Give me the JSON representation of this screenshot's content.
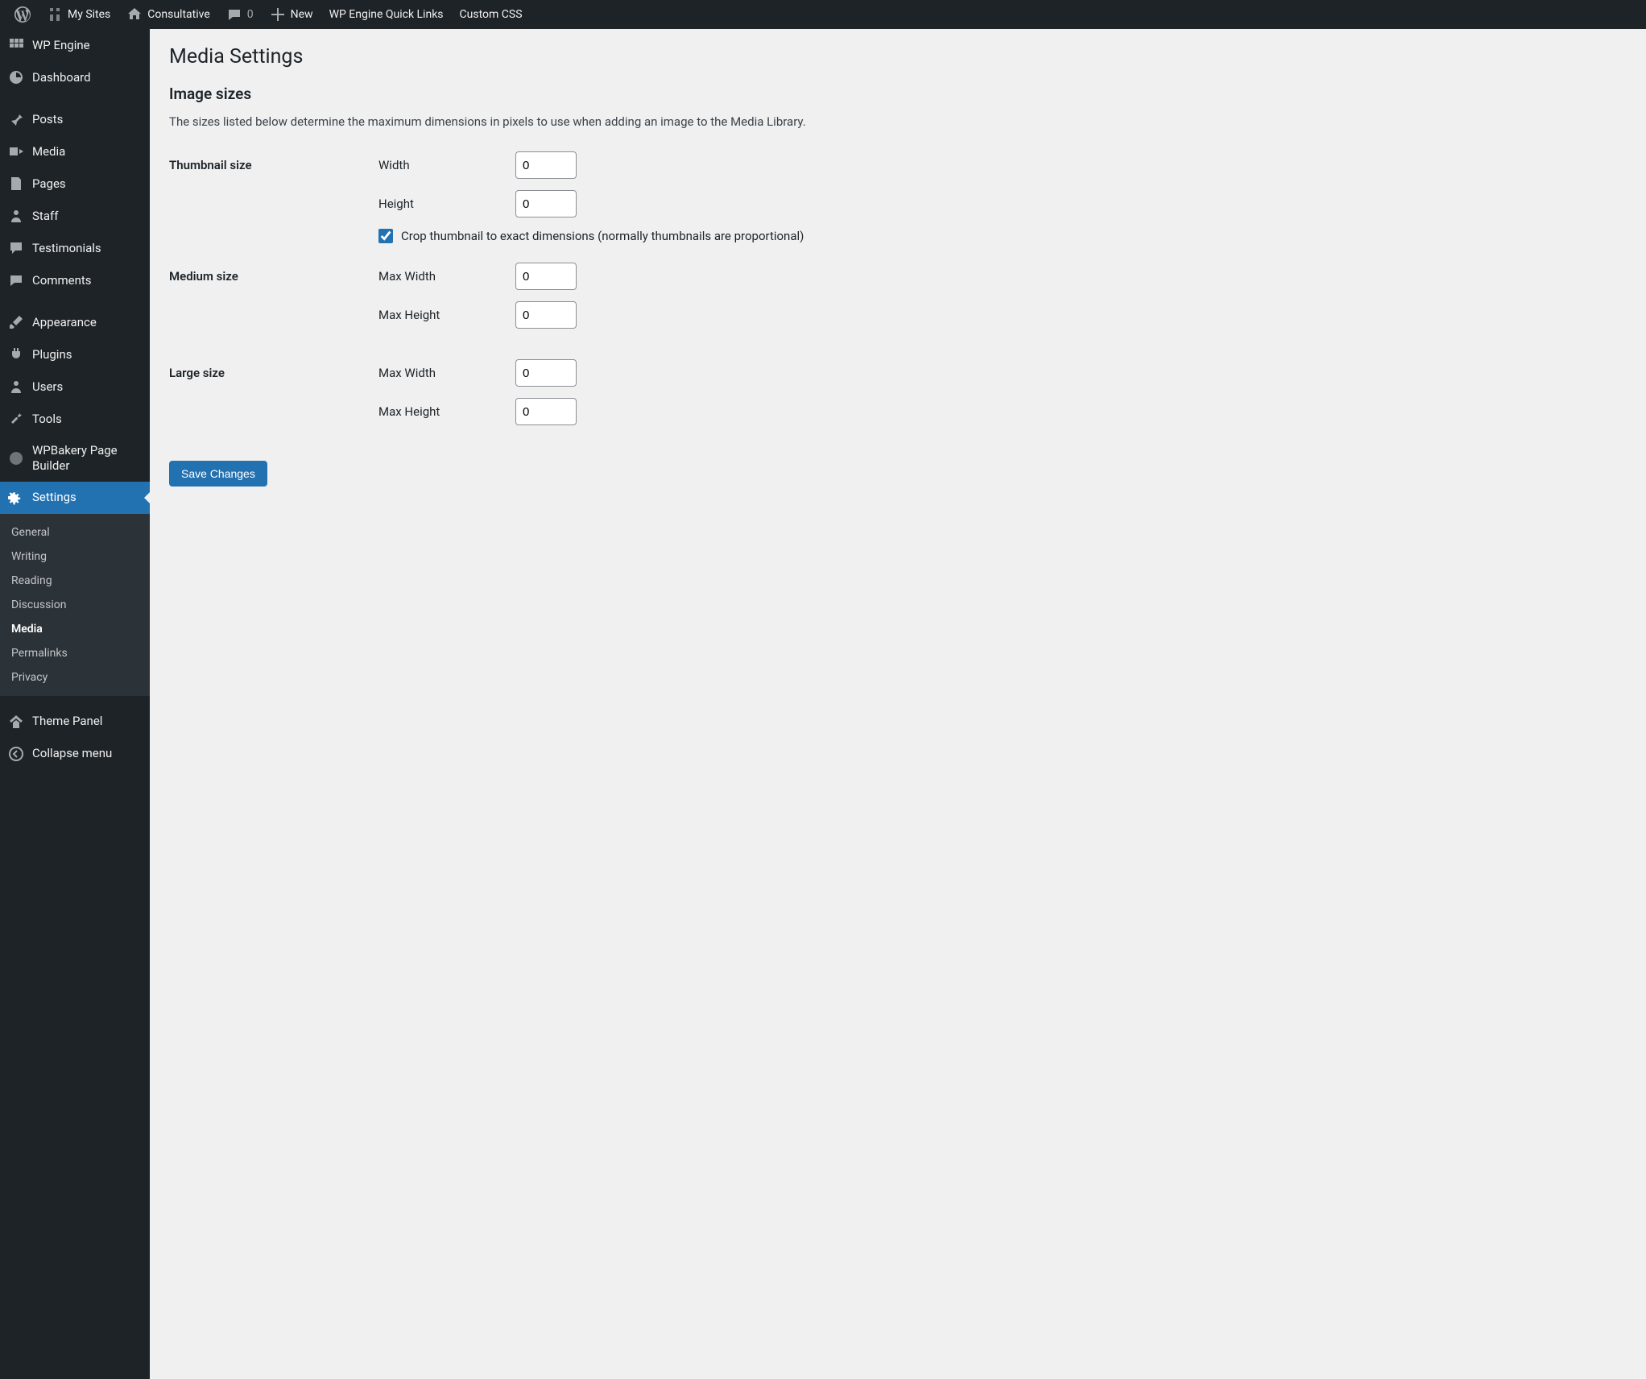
{
  "adminbar": {
    "mysites": "My Sites",
    "sitename": "Consultative",
    "comments": "0",
    "new": "New",
    "wpengine": "WP Engine Quick Links",
    "customcss": "Custom CSS"
  },
  "sidebar": {
    "wpengine": "WP Engine",
    "dashboard": "Dashboard",
    "posts": "Posts",
    "media": "Media",
    "pages": "Pages",
    "staff": "Staff",
    "testimonials": "Testimonials",
    "comments": "Comments",
    "appearance": "Appearance",
    "plugins": "Plugins",
    "users": "Users",
    "tools": "Tools",
    "wpbakery": "WPBakery Page Builder",
    "settings": "Settings",
    "themepanel": "Theme Panel",
    "collapse": "Collapse menu"
  },
  "submenu": {
    "general": "General",
    "writing": "Writing",
    "reading": "Reading",
    "discussion": "Discussion",
    "media": "Media",
    "permalinks": "Permalinks",
    "privacy": "Privacy"
  },
  "page": {
    "title": "Media Settings",
    "section": "Image sizes",
    "desc": "The sizes listed below determine the maximum dimensions in pixels to use when adding an image to the Media Library.",
    "thumbnail": {
      "heading": "Thumbnail size",
      "width_label": "Width",
      "width_value": "0",
      "height_label": "Height",
      "height_value": "0",
      "crop_label": "Crop thumbnail to exact dimensions (normally thumbnails are proportional)",
      "crop_checked": true
    },
    "medium": {
      "heading": "Medium size",
      "maxwidth_label": "Max Width",
      "maxwidth_value": "0",
      "maxheight_label": "Max Height",
      "maxheight_value": "0"
    },
    "large": {
      "heading": "Large size",
      "maxwidth_label": "Max Width",
      "maxwidth_value": "0",
      "maxheight_label": "Max Height",
      "maxheight_value": "0"
    },
    "save": "Save Changes"
  }
}
